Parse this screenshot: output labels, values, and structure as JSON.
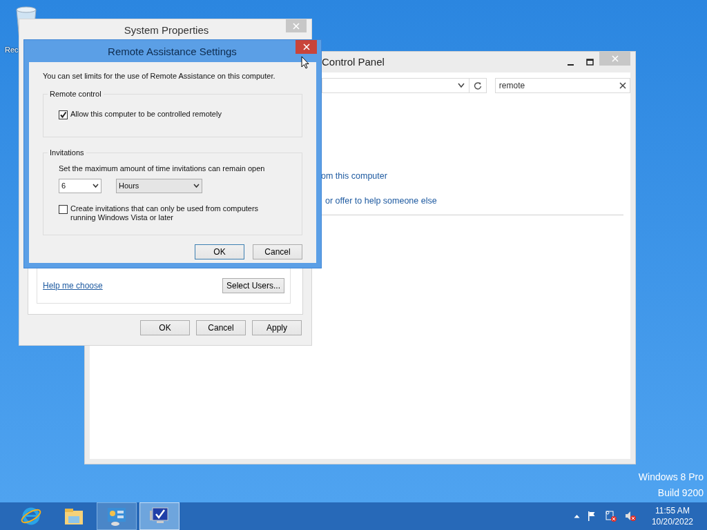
{
  "desktop": {
    "icons": [
      {
        "label": "Rec"
      }
    ],
    "edition": [
      "Windows 8 Pro",
      "Build 9200"
    ]
  },
  "control_panel": {
    "title": "Control Panel",
    "search": {
      "value": "remote"
    },
    "links": [
      "om this computer",
      "or offer to help someone else"
    ]
  },
  "system_properties": {
    "title": "System Properties",
    "help_link": "Help me choose",
    "select_users": "Select Users...",
    "buttons": [
      {
        "label": "OK",
        "default": false
      },
      {
        "label": "Cancel",
        "default": false
      },
      {
        "label": "Apply",
        "default": false
      }
    ]
  },
  "remote_assistance": {
    "title": "Remote Assistance Settings",
    "intro": "You can set limits for the use of Remote Assistance on this computer.",
    "remote_control": {
      "legend": "Remote control",
      "checkbox": {
        "label": "Allow this computer to be controlled remotely",
        "checked": true
      }
    },
    "invitations": {
      "legend": "Invitations",
      "prompt": "Set the maximum amount of time invitations can remain open",
      "amount": "6",
      "unit": "Hours",
      "checkbox": {
        "label": "Create invitations that can only be used from computers running Windows Vista or later",
        "checked": false
      }
    },
    "buttons": [
      {
        "label": "OK",
        "default": true
      },
      {
        "label": "Cancel",
        "default": false
      }
    ]
  },
  "taskbar": {
    "apps": [
      {
        "kind": "browser",
        "running": false,
        "selected": false
      },
      {
        "kind": "folder",
        "running": false,
        "selected": false
      },
      {
        "kind": "control-panel",
        "running": true,
        "selected": false
      },
      {
        "kind": "system",
        "running": true,
        "selected": true
      }
    ],
    "clock": {
      "time": "11:55 AM",
      "date": "10/20/2022"
    }
  }
}
